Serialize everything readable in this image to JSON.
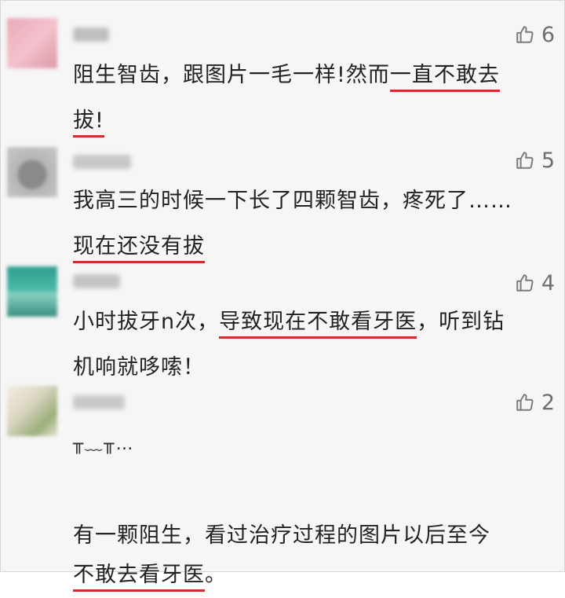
{
  "comments": [
    {
      "likes": "6",
      "lines": [
        {
          "pre": "阻生智齿，跟图片一毛一样!然而",
          "ul": "一直不敢去",
          "post": ""
        },
        {
          "pre": "",
          "ul": "拔!",
          "post": ""
        }
      ]
    },
    {
      "likes": "5",
      "lines": [
        {
          "pre": "我高三的时候一下长了四颗智齿，疼死了……",
          "ul": "",
          "post": ""
        },
        {
          "pre": "",
          "ul": "现在还没有拔",
          "post": ""
        }
      ]
    },
    {
      "likes": "4",
      "lines": [
        {
          "pre": "小时拔牙n次，",
          "ul": "导致现在不敢看牙医",
          "post": "，听到钻"
        },
        {
          "pre": "机响就哆嗦！",
          "ul": "",
          "post": ""
        }
      ]
    },
    {
      "likes": "2",
      "lines": [
        {
          "pre": "╥﹏╥…",
          "ul": "",
          "post": ""
        },
        {
          "pre": "",
          "ul": "",
          "post": ""
        },
        {
          "pre": "有一颗阻生，看过治疗过程的图片以后至今",
          "ul": "",
          "post": ""
        },
        {
          "pre": "",
          "ul": "不敢去看牙医",
          "post": "。"
        }
      ]
    }
  ],
  "colors": {
    "underline": "#d32a2a",
    "text": "#222222",
    "like": "#7a7a7a"
  },
  "icons": {
    "like": "thumbs-up-icon"
  }
}
